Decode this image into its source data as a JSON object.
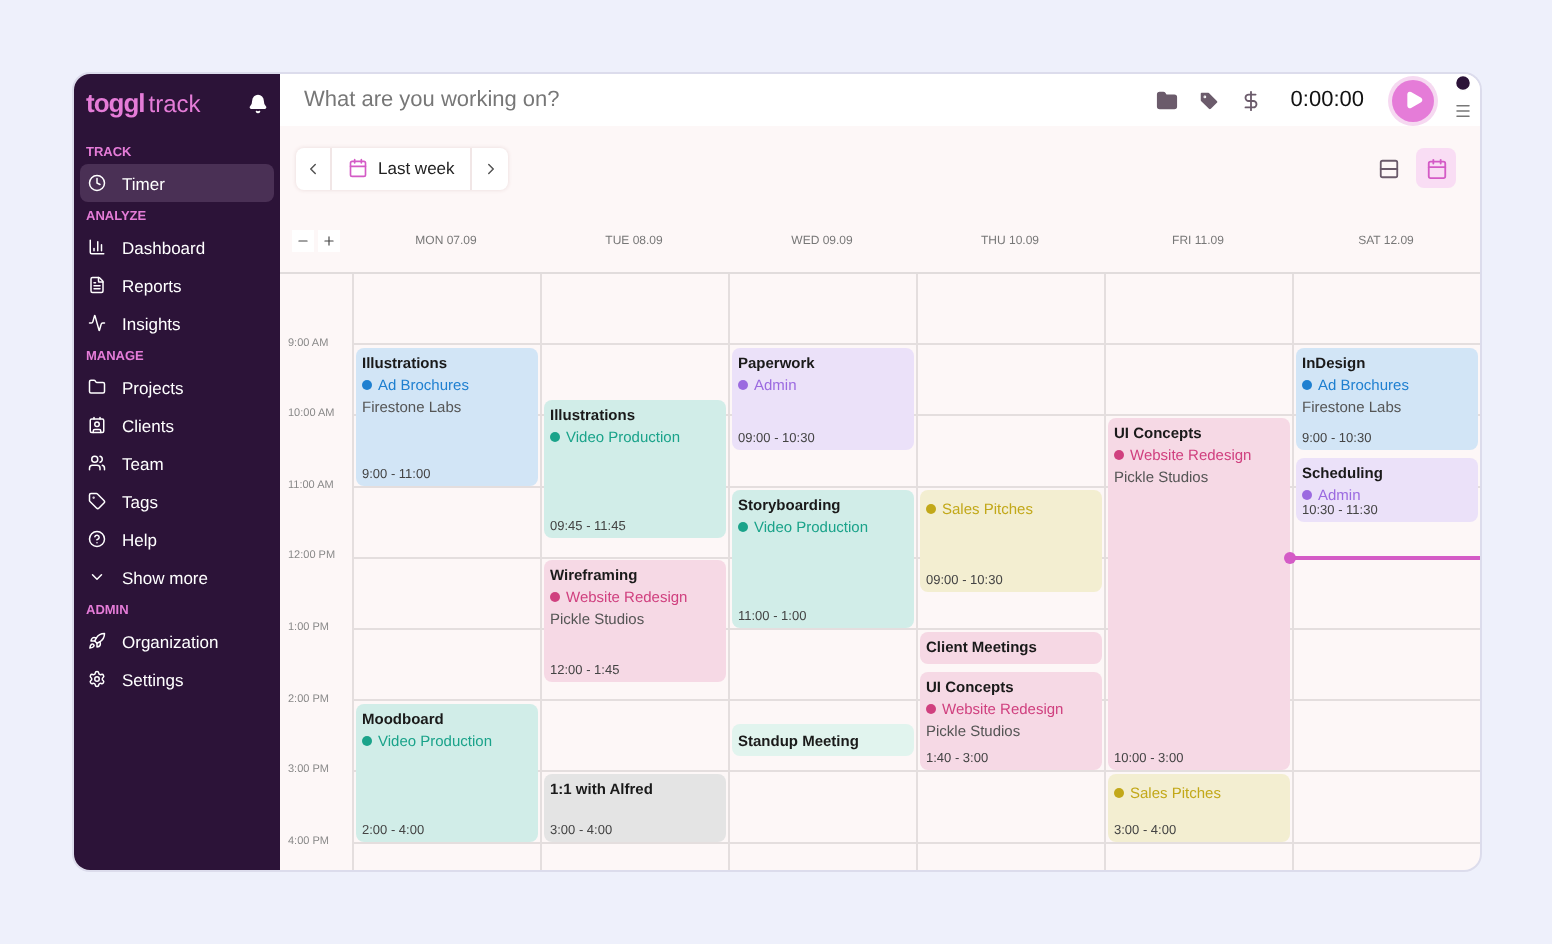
{
  "sidebar": {
    "logo_brand": "toggl",
    "logo_product": "track",
    "sections": [
      {
        "title": "TRACK",
        "items": [
          {
            "label": "Timer",
            "selected": true
          }
        ]
      },
      {
        "title": "ANALYZE",
        "items": [
          {
            "label": "Dashboard",
            "selected": false
          },
          {
            "label": "Reports",
            "selected": false
          },
          {
            "label": "Insights",
            "selected": false
          }
        ]
      },
      {
        "title": "MANAGE",
        "items": [
          {
            "label": "Projects",
            "selected": false
          },
          {
            "label": "Clients",
            "selected": false
          },
          {
            "label": "Team",
            "selected": false
          },
          {
            "label": "Tags",
            "selected": false
          },
          {
            "label": "Help",
            "selected": false
          },
          {
            "label": "Show more",
            "selected": false
          }
        ]
      },
      {
        "title": "ADMIN",
        "items": [
          {
            "label": "Organization",
            "selected": false
          },
          {
            "label": "Settings",
            "selected": false
          }
        ]
      }
    ]
  },
  "timer_bar": {
    "placeholder": "What are you working on?",
    "duration": "0:00:00"
  },
  "toolbar": {
    "range": "Last week",
    "views": [
      {
        "kind": "list",
        "selected": false
      },
      {
        "kind": "calendar",
        "selected": true
      }
    ]
  },
  "calendar": {
    "hours": [
      "9:00 AM",
      "10:00 AM",
      "11:00 AM",
      "12:00 PM",
      "1:00 PM",
      "2:00 PM",
      "3:00 PM",
      "4:00 PM"
    ],
    "days": [
      {
        "label": "MON 07.09",
        "events": [
          {
            "title": "Illustrations",
            "project": "Ad Brochures",
            "client": "Firestone Labs",
            "time": "9:00 - 11:00",
            "color": "#1e7fd0"
          },
          {
            "title": "Moodboard",
            "project": "Video Production",
            "time": "2:00 - 4:00",
            "color": "#1aa38a"
          }
        ]
      },
      {
        "label": "TUE 08.09",
        "events": [
          {
            "title": "Illustrations",
            "project": "Video Production",
            "time": "09:45 - 11:45",
            "color": "#1aa38a"
          },
          {
            "title": "Wireframing",
            "project": "Website Redesign",
            "client": "Pickle Studios",
            "time": "12:00 - 1:45",
            "color": "#d0407f"
          },
          {
            "title": "1:1 with Alfred",
            "time": "3:00 - 4:00",
            "color": "#e4e4e4"
          }
        ]
      },
      {
        "label": "WED 09.09",
        "events": [
          {
            "title": "Paperwork",
            "project": "Admin",
            "time": "09:00 - 10:30",
            "color": "#9b6ae0"
          },
          {
            "title": "Storyboarding",
            "project": "Video Production",
            "time": "11:00 - 1:00",
            "color": "#1aa38a"
          },
          {
            "title": "Standup Meeting",
            "color": "#e1f4ee"
          }
        ]
      },
      {
        "label": "THU 10.09",
        "events": [
          {
            "project": "Sales Pitches",
            "time": "09:00 - 10:30",
            "color": "#c2a819"
          },
          {
            "title": "Client Meetings",
            "color": "#f6d8e4"
          },
          {
            "title": "UI Concepts",
            "project": "Website Redesign",
            "client": "Pickle Studios",
            "time": "1:40 - 3:00",
            "color": "#d0407f"
          }
        ]
      },
      {
        "label": "FRI 11.09",
        "events": [
          {
            "title": "UI Concepts",
            "project": "Website Redesign",
            "client": "Pickle Studios",
            "time": "10:00 - 3:00",
            "color": "#d0407f"
          },
          {
            "project": "Sales Pitches",
            "time": "3:00 - 4:00",
            "color": "#c2a819"
          }
        ]
      },
      {
        "label": "SAT 12.09",
        "now_line": true,
        "events": [
          {
            "title": "InDesign",
            "project": "Ad Brochures",
            "client": "Firestone Labs",
            "time": "9:00 - 10:30",
            "color": "#1e7fd0"
          },
          {
            "title": "Scheduling",
            "project": "Admin",
            "time": "10:30 - 11:30",
            "color": "#9b6ae0"
          }
        ]
      }
    ]
  }
}
